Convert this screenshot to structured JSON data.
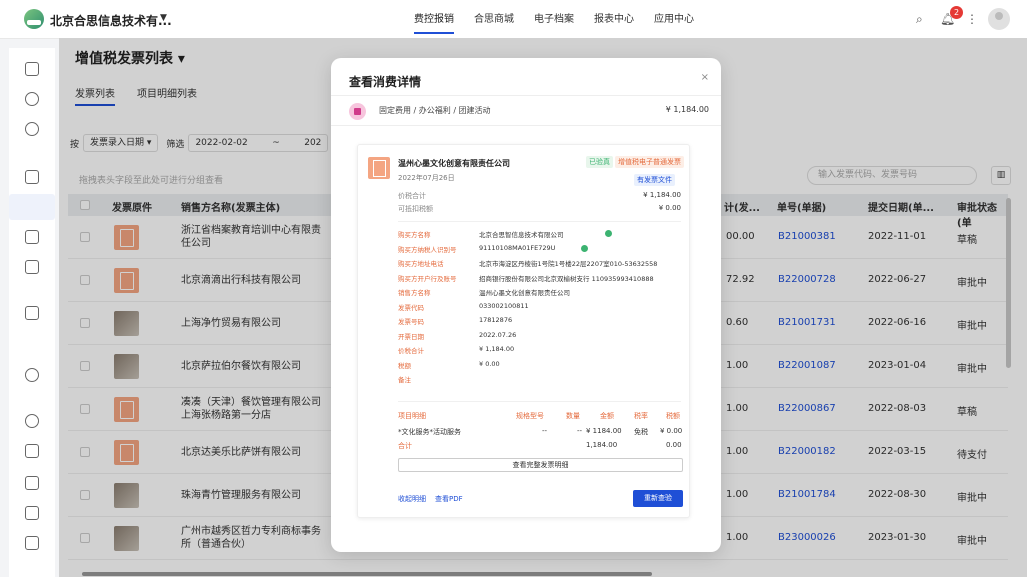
{
  "topbar": {
    "company": "北京合思信息技术有...",
    "nav": [
      "费控报销",
      "合思商城",
      "电子档案",
      "报表中心",
      "应用中心"
    ],
    "notification_count": "2"
  },
  "page": {
    "title": "增值税发票列表",
    "tabs": [
      "发票列表",
      "项目明细列表"
    ],
    "filter_prefix": "按",
    "date_type": "发票录入日期",
    "filter_label": "筛选",
    "date_start": "2022-02-02",
    "date_sep": "~",
    "date_end_partial": "202",
    "group_hint": "拖拽表头字段至此处可进行分组查看",
    "search_placeholder": "输入发票代码、发票号码"
  },
  "table": {
    "headers": [
      "发票原件",
      "销售方名称(发票主体)",
      "计(发...",
      "单号(单据)",
      "提交日期(单...",
      "审批状态(单"
    ],
    "rows": [
      {
        "thumb": "pdf",
        "seller": "浙江省档案教育培训中心有限责任公司",
        "amt": "00.00",
        "no": "B21000381",
        "date": "2022-11-01",
        "status": "草稿"
      },
      {
        "thumb": "pdf",
        "seller": "北京滴滴出行科技有限公司",
        "amt": "72.92",
        "no": "B22000728",
        "date": "2022-06-27",
        "status": "审批中"
      },
      {
        "thumb": "photo",
        "seller": "上海净竹贸易有限公司",
        "amt": "0.60",
        "no": "B21001731",
        "date": "2022-06-16",
        "status": "审批中"
      },
      {
        "thumb": "photo",
        "seller": "北京萨拉伯尔餐饮有限公司",
        "amt": "1.00",
        "no": "B22001087",
        "date": "2023-01-04",
        "status": "审批中"
      },
      {
        "thumb": "pdf",
        "seller": "凑凑（天津）餐饮管理有限公司上海张杨路第一分店",
        "amt": "1.00",
        "no": "B22000867",
        "date": "2022-08-03",
        "status": "草稿"
      },
      {
        "thumb": "pdf",
        "seller": "北京达美乐比萨饼有限公司",
        "amt": "1.00",
        "no": "B22000182",
        "date": "2022-03-15",
        "status": "待支付"
      },
      {
        "thumb": "photo",
        "seller": "珠海青竹管理服务有限公司",
        "amt": "1.00",
        "no": "B21001784",
        "date": "2022-08-30",
        "status": "审批中"
      },
      {
        "thumb": "photo",
        "seller": "广州市越秀区哲力专利商标事务所（普通合伙）",
        "amt": "1.00",
        "no": "B23000026",
        "date": "2023-01-30",
        "status": "审批中"
      }
    ]
  },
  "modal": {
    "title": "查看消费详情",
    "category": "固定费用 / 办公福利 / 团建活动",
    "category_amount": "¥ 1,184.00",
    "invoice": {
      "seller": "温州心墨文化创意有限责任公司",
      "date": "2022年07月26日",
      "tag_verified": "已验真",
      "tag_type": "增值税电子普通发票",
      "tag_file": "有发票文件",
      "total_label": "价税合计",
      "total_value": "¥ 1,184.00",
      "deduct_label": "可抵扣税额",
      "deduct_value": "¥ 0.00",
      "fields": [
        {
          "k": "购买方名称",
          "v": "北京合思智信息技术有限公司"
        },
        {
          "k": "购买方纳税人识别号",
          "v": "91110108MA01FE729U"
        },
        {
          "k": "购买方地址电话",
          "v": "北京市海淀区丹棱街1号院1号楼22层2207室010-53632558"
        },
        {
          "k": "购买方开户行及账号",
          "v": "招商银行股份有限公司北京双榆树支行 110935993410888"
        },
        {
          "k": "销售方名称",
          "v": "温州心墨文化创意有限责任公司"
        },
        {
          "k": "发票代码",
          "v": "033002100811"
        },
        {
          "k": "发票号码",
          "v": "17812876"
        },
        {
          "k": "开票日期",
          "v": "2022.07.26"
        },
        {
          "k": "价税合计",
          "v": "¥ 1,184.00"
        },
        {
          "k": "税额",
          "v": "¥ 0.00"
        },
        {
          "k": "备注",
          "v": ""
        }
      ],
      "detail_headers": [
        "项目明细",
        "规格型号",
        "数量",
        "金额",
        "税率",
        "税额"
      ],
      "detail_row": [
        "*文化服务*活动服务",
        "--",
        "--",
        "¥ 1184.00",
        "免税",
        "¥ 0.00"
      ],
      "sum_label": "合计",
      "sum_amount": "1,184.00",
      "sum_tax": "0.00",
      "view_all": "查看完整发票明细",
      "collapse": "收起明细",
      "view_pdf": "查看PDF",
      "recheck": "重新查验"
    },
    "close": "×"
  },
  "colors": {
    "accent": "#1f4fd6",
    "orange": "#e46a3c",
    "green": "#3cb371"
  }
}
